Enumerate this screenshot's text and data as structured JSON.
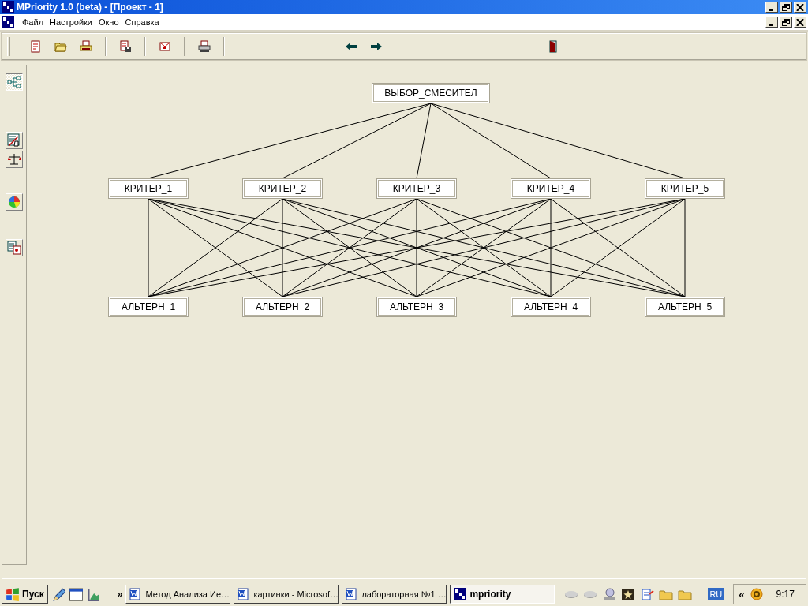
{
  "window": {
    "title": "MPriority 1.0 (beta) - [Проект - 1]"
  },
  "menu": [
    "Файл",
    "Настройки",
    "Окно",
    "Справка"
  ],
  "left_toolbar": [
    {
      "selected": true
    },
    {
      "selected": false
    },
    {
      "selected": false
    },
    {
      "selected": false
    },
    {
      "selected": false
    }
  ],
  "hierarchy": {
    "goal": "ВЫБОР_СМЕСИТЕЛ",
    "criteria": [
      "КРИТЕР_1",
      "КРИТЕР_2",
      "КРИТЕР_3",
      "КРИТЕР_4",
      "КРИТЕР_5"
    ],
    "alternatives": [
      "АЛЬТЕРН_1",
      "АЛЬТЕРН_2",
      "АЛЬТЕРН_3",
      "АЛЬТЕРН_4",
      "АЛЬТЕРН_5"
    ]
  },
  "taskbar": {
    "start": "Пуск",
    "more": "»",
    "tasks": [
      {
        "label": "Метод Анализа Ие…",
        "selected": false
      },
      {
        "label": "картинки - Microsof…",
        "selected": false
      },
      {
        "label": "лабораторная №1 …",
        "selected": false
      },
      {
        "label": "mpriority",
        "selected": true
      }
    ],
    "language": "RU",
    "tray_expand": "«",
    "clock": "9:17"
  }
}
